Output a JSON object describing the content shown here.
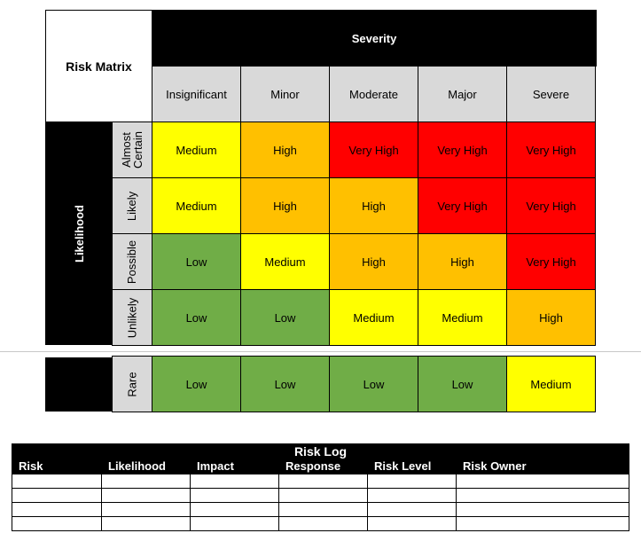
{
  "matrix": {
    "title": "Risk Matrix",
    "severity_label": "Severity",
    "likelihood_label": "Likelihood",
    "severity_levels": [
      "Insignificant",
      "Minor",
      "Moderate",
      "Major",
      "Severe"
    ],
    "likelihood_levels": [
      "Almost\nCertain",
      "Likely",
      "Possible",
      "Unlikely",
      "Rare"
    ],
    "rows": [
      [
        "Medium",
        "High",
        "Very High",
        "Very High",
        "Very High"
      ],
      [
        "Medium",
        "High",
        "High",
        "Very High",
        "Very High"
      ],
      [
        "Low",
        "Medium",
        "High",
        "High",
        "Very High"
      ],
      [
        "Low",
        "Low",
        "Medium",
        "Medium",
        "High"
      ],
      [
        "Low",
        "Low",
        "Low",
        "Low",
        "Medium"
      ]
    ],
    "level_colors": {
      "Low": "#70ad47",
      "Medium": "#ffff00",
      "High": "#ffc000",
      "Very High": "#ff0000"
    }
  },
  "risk_log": {
    "title": "Risk Log",
    "columns": [
      "Risk",
      "Likelihood",
      "Impact",
      "Response",
      "Risk Level",
      "Risk Owner"
    ],
    "rows": [
      [
        "",
        "",
        "",
        "",
        "",
        ""
      ],
      [
        "",
        "",
        "",
        "",
        "",
        ""
      ],
      [
        "",
        "",
        "",
        "",
        "",
        ""
      ],
      [
        "",
        "",
        "",
        "",
        "",
        ""
      ]
    ]
  }
}
